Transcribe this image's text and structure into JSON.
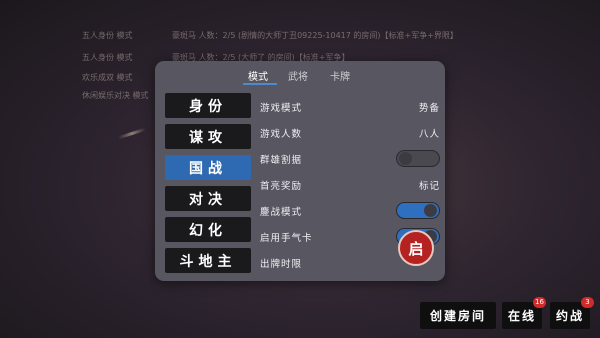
{
  "background_list": [
    {
      "mode": "五人身份 模式",
      "detail": "豪斑马   人数：2/5   (剧情的大师丁丑09225-10417 的房间)【标准+军争+界限】"
    },
    {
      "mode": "五人身份 模式",
      "detail": "豪斑马   人数：2/5   (大师了 的房间)【标准+军争】"
    },
    {
      "mode": "欢乐成双 模式",
      "detail": ""
    },
    {
      "mode": "休闲娱乐对决 模式",
      "detail": ""
    }
  ],
  "modal": {
    "tabs": [
      "模式",
      "武将",
      "卡牌"
    ],
    "active_tab": "模式",
    "categories": [
      "身份",
      "谋攻",
      "国战",
      "对决",
      "幻化",
      "斗地主"
    ],
    "selected_category": "国战",
    "options": [
      {
        "name": "游戏模式",
        "value": "势备"
      },
      {
        "name": "游戏人数",
        "value": "八人"
      },
      {
        "name": "群雄割据",
        "toggle": "off"
      },
      {
        "name": "首亮奖励",
        "value": "标记"
      },
      {
        "name": "鏖战模式",
        "toggle": "on"
      },
      {
        "name": "启用手气卡",
        "toggle": "on"
      },
      {
        "name": "出牌时限",
        "value": ""
      }
    ],
    "start_label": "启"
  },
  "bottom_bar": {
    "create_room": "创建房间",
    "online": "在线",
    "online_badge": "16",
    "invite": "约战",
    "invite_badge": "3"
  },
  "colors": {
    "accent": "#2e6ab2",
    "toggle_on": "#2f6fc0",
    "start_button": "#b42222",
    "badge": "#d02a2a"
  }
}
